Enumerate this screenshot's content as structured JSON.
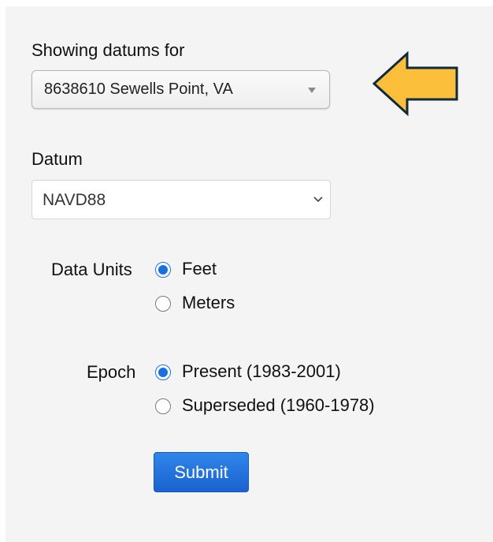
{
  "form": {
    "station_label": "Showing datums for",
    "station_value": "8638610 Sewells Point, VA",
    "datum_label": "Datum",
    "datum_value": "NAVD88",
    "units_label": "Data Units",
    "units_options": [
      {
        "label": "Feet",
        "selected": true
      },
      {
        "label": "Meters",
        "selected": false
      }
    ],
    "epoch_label": "Epoch",
    "epoch_options": [
      {
        "label": "Present (1983-2001)",
        "selected": true
      },
      {
        "label": "Superseded (1960-1978)",
        "selected": false
      }
    ],
    "submit_label": "Submit"
  },
  "annotation": {
    "arrow_icon": "left-arrow-icon",
    "arrow_fill": "#fbbf3c",
    "arrow_stroke": "#0f2a3a"
  },
  "colors": {
    "panel_bg": "#f4f4f4",
    "radio_selected": "#1a6fe0",
    "button_bg": "#1f6fdc"
  }
}
